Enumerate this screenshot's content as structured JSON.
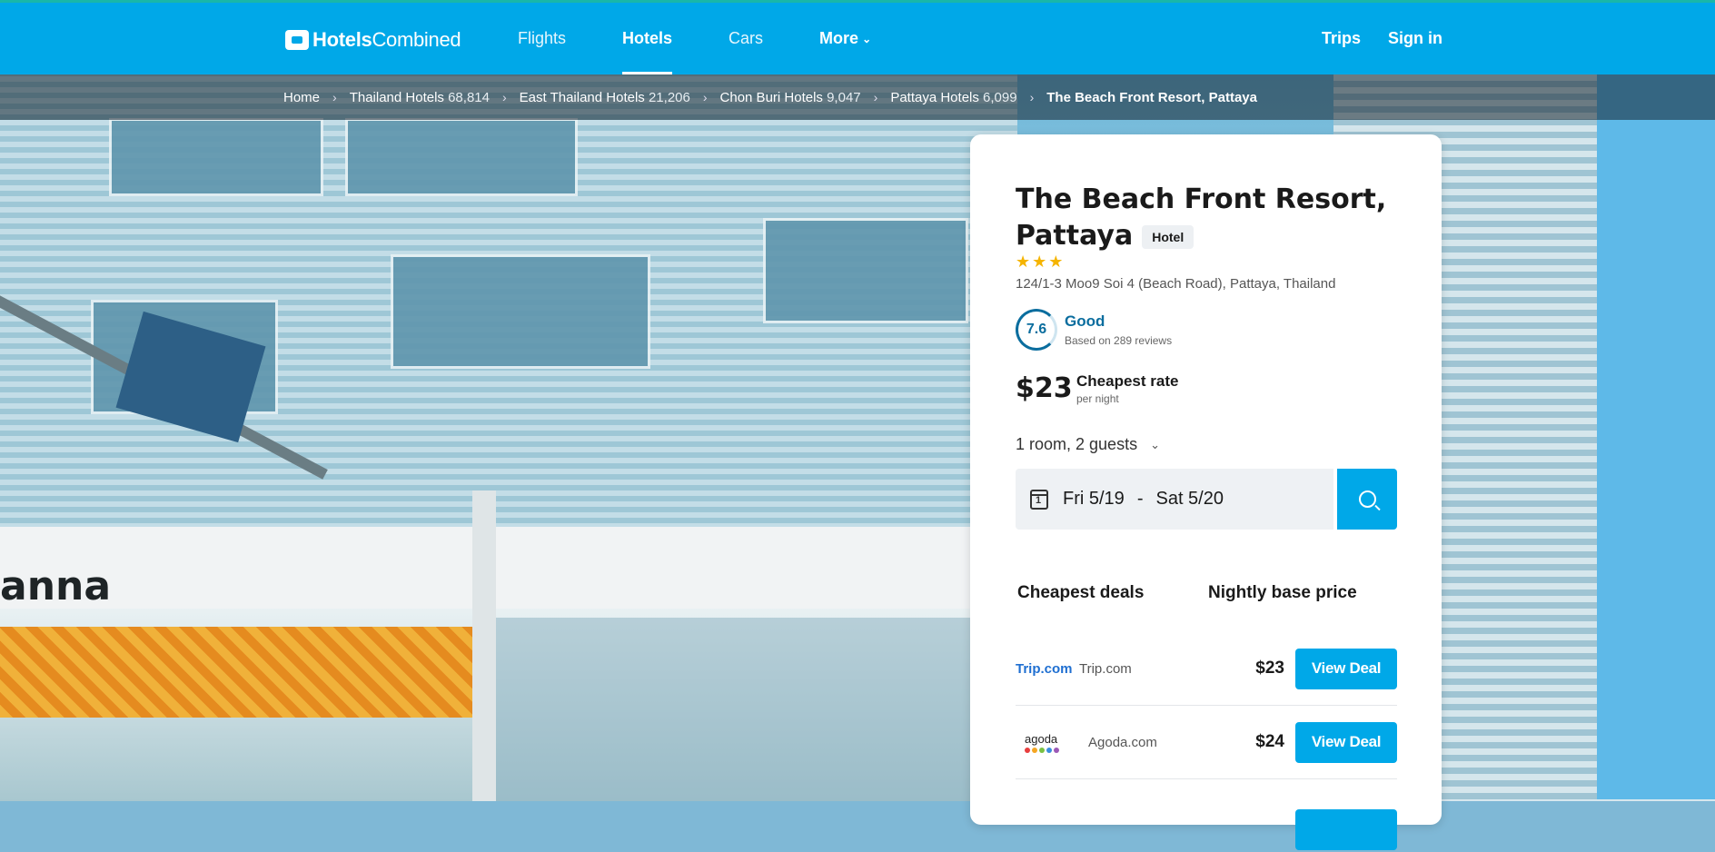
{
  "brand": {
    "logo_bold": "Hotels",
    "logo_rest": "Combined"
  },
  "nav": {
    "items": [
      {
        "label": "Flights"
      },
      {
        "label": "Hotels"
      },
      {
        "label": "Cars"
      },
      {
        "label": "More"
      }
    ],
    "right": {
      "trips": "Trips",
      "sign_in": "Sign in"
    }
  },
  "breadcrumb": {
    "items": [
      {
        "label": "Home",
        "count": ""
      },
      {
        "label": "Thailand Hotels",
        "count": "68,814"
      },
      {
        "label": "East Thailand Hotels",
        "count": "21,206"
      },
      {
        "label": "Chon Buri Hotels",
        "count": "9,047"
      },
      {
        "label": "Pattaya Hotels",
        "count": "6,099"
      }
    ],
    "current": "The Beach Front Resort, Pattaya"
  },
  "hero": {
    "shop_sign": "anna"
  },
  "hotel": {
    "name": "The Beach Front Resort, Pattaya",
    "type_badge": "Hotel",
    "stars": 3,
    "stars_display": "★★★",
    "address": "124/1-3 Moo9 Soi 4 (Beach Road), Pattaya, Thailand",
    "score": "7.6",
    "rating_word": "Good",
    "reviews": "Based on 289 reviews",
    "price": "$23",
    "price_label": "Cheapest rate",
    "price_sub": "per night"
  },
  "search": {
    "guests": "1 room, 2 guests",
    "check_in": "Fri 5/19",
    "dash": "-",
    "check_out": "Sat 5/20"
  },
  "deals": {
    "header_left": "Cheapest deals",
    "header_right": "Nightly base price",
    "rows": [
      {
        "logo": "Trip.com",
        "name": "Trip.com",
        "price": "$23",
        "button": "View Deal"
      },
      {
        "logo": "agoda",
        "name": "Agoda.com",
        "price": "$24",
        "button": "View Deal"
      }
    ]
  },
  "colors": {
    "brand": "#00a8e8",
    "rating": "#0a6d9e",
    "star": "#f5b400"
  }
}
